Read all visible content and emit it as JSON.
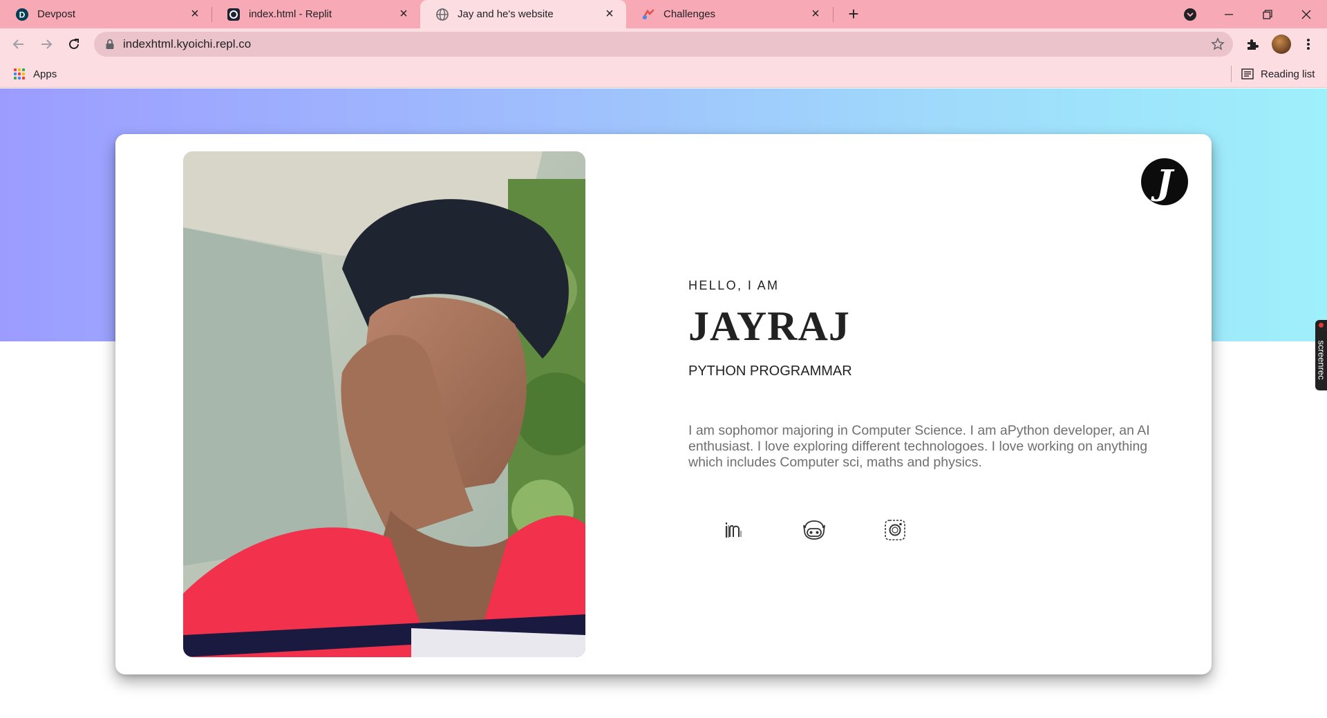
{
  "browser": {
    "tabs": [
      {
        "title": "Devpost",
        "icon": "devpost-icon",
        "active": false
      },
      {
        "title": "index.html - Replit",
        "icon": "replit-icon",
        "active": false
      },
      {
        "title": "Jay and he's website",
        "icon": "globe-icon",
        "active": true
      },
      {
        "title": "Challenges",
        "icon": "challenges-icon",
        "active": false
      }
    ],
    "url": "indexhtml.kyoichi.repl.co",
    "bookmarks": {
      "apps_label": "Apps",
      "reading_list_label": "Reading list"
    }
  },
  "profile": {
    "greeting": "HELLO, I AM",
    "name": "JAYRAJ",
    "role": "PYTHON PROGRAMMAR",
    "bio": "I am sophomor majoring in Computer Science. I am aPython developer, an AI enthusiast. I love exploring different technologoes. I love working on anything which includes Computer sci, maths and physics.",
    "logo_letter": "J",
    "socials": [
      {
        "icon": "linkedin-icon"
      },
      {
        "icon": "github-icon"
      },
      {
        "icon": "instagram-icon"
      }
    ]
  },
  "overlay": {
    "screenrec_label": "screenrec"
  },
  "colors": {
    "tabbar": "#f8a9b6",
    "toolbar": "#fbdde2",
    "hero_gradient_start": "#9c9cff",
    "hero_gradient_end": "#9ef0fb"
  }
}
